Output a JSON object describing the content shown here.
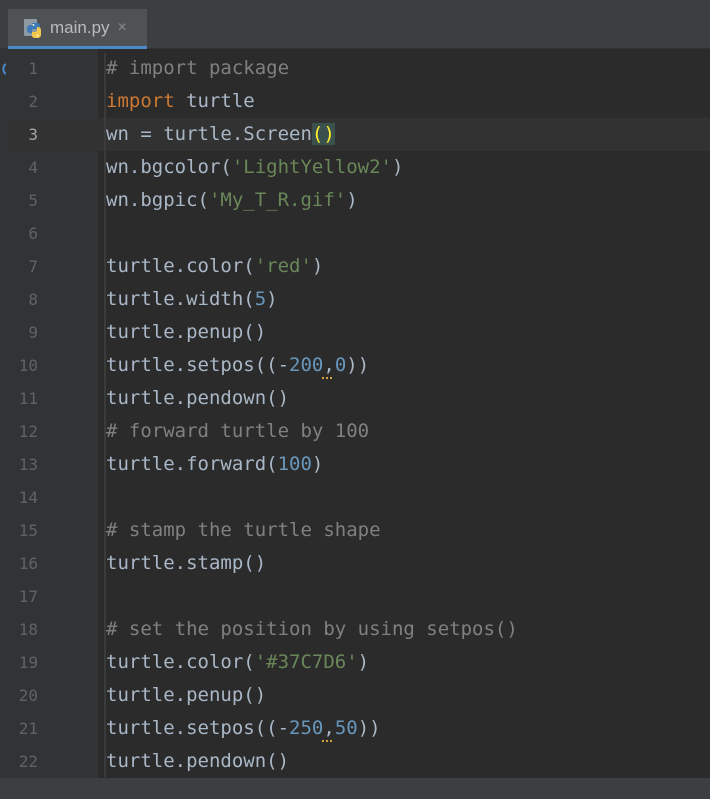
{
  "tab": {
    "filename": "main.py",
    "close_glyph": "×",
    "icon": "python-file-icon"
  },
  "colors": {
    "keyword": "#cc7832",
    "string": "#6a8759",
    "number": "#6897bb",
    "comment": "#808080",
    "text": "#a9b7c6",
    "background": "#2b2b2b"
  },
  "current_line": 3,
  "lines": [
    {
      "n": "1",
      "tokens": [
        {
          "t": "# import package",
          "c": "cmt"
        }
      ]
    },
    {
      "n": "2",
      "tokens": [
        {
          "t": "import",
          "c": "kw"
        },
        {
          "t": " turtle",
          "c": ""
        }
      ]
    },
    {
      "n": "3",
      "tokens": [
        {
          "t": "wn = turtle.Screen",
          "c": ""
        },
        {
          "t": "()",
          "c": "paren-hl"
        }
      ]
    },
    {
      "n": "4",
      "tokens": [
        {
          "t": "wn.bgcolor(",
          "c": ""
        },
        {
          "t": "'LightYellow2'",
          "c": "str"
        },
        {
          "t": ")",
          "c": ""
        }
      ]
    },
    {
      "n": "5",
      "tokens": [
        {
          "t": "wn.bgpic(",
          "c": ""
        },
        {
          "t": "'My_T_R.gif'",
          "c": "str"
        },
        {
          "t": ")",
          "c": ""
        }
      ]
    },
    {
      "n": "6",
      "tokens": []
    },
    {
      "n": "7",
      "tokens": [
        {
          "t": "turtle.color(",
          "c": ""
        },
        {
          "t": "'red'",
          "c": "str"
        },
        {
          "t": ")",
          "c": ""
        }
      ]
    },
    {
      "n": "8",
      "tokens": [
        {
          "t": "turtle.width(",
          "c": ""
        },
        {
          "t": "5",
          "c": "num"
        },
        {
          "t": ")",
          "c": ""
        }
      ]
    },
    {
      "n": "9",
      "tokens": [
        {
          "t": "turtle.penup()",
          "c": ""
        }
      ]
    },
    {
      "n": "10",
      "tokens": [
        {
          "t": "turtle.setpos((-",
          "c": ""
        },
        {
          "t": "200",
          "c": "num"
        },
        {
          "t": ",",
          "c": "squig"
        },
        {
          "t": "0",
          "c": "num"
        },
        {
          "t": "))",
          "c": ""
        }
      ]
    },
    {
      "n": "11",
      "tokens": [
        {
          "t": "turtle.pendown()",
          "c": ""
        }
      ]
    },
    {
      "n": "12",
      "tokens": [
        {
          "t": "# forward turtle by 100",
          "c": "cmt"
        }
      ]
    },
    {
      "n": "13",
      "tokens": [
        {
          "t": "turtle.forward(",
          "c": ""
        },
        {
          "t": "100",
          "c": "num"
        },
        {
          "t": ")",
          "c": ""
        }
      ]
    },
    {
      "n": "14",
      "tokens": []
    },
    {
      "n": "15",
      "tokens": [
        {
          "t": "# stamp the turtle shape",
          "c": "cmt"
        }
      ]
    },
    {
      "n": "16",
      "tokens": [
        {
          "t": "turtle.stamp()",
          "c": ""
        }
      ]
    },
    {
      "n": "17",
      "tokens": []
    },
    {
      "n": "18",
      "tokens": [
        {
          "t": "# set the position by using setpos()",
          "c": "cmt"
        }
      ]
    },
    {
      "n": "19",
      "tokens": [
        {
          "t": "turtle.color(",
          "c": ""
        },
        {
          "t": "'#37C7D6'",
          "c": "str"
        },
        {
          "t": ")",
          "c": ""
        }
      ]
    },
    {
      "n": "20",
      "tokens": [
        {
          "t": "turtle.penup()",
          "c": ""
        }
      ]
    },
    {
      "n": "21",
      "tokens": [
        {
          "t": "turtle.setpos((-",
          "c": ""
        },
        {
          "t": "250",
          "c": "num"
        },
        {
          "t": ",",
          "c": "squig"
        },
        {
          "t": "50",
          "c": "num"
        },
        {
          "t": "))",
          "c": ""
        }
      ]
    },
    {
      "n": "22",
      "tokens": [
        {
          "t": "turtle.pendown()",
          "c": ""
        }
      ]
    }
  ]
}
